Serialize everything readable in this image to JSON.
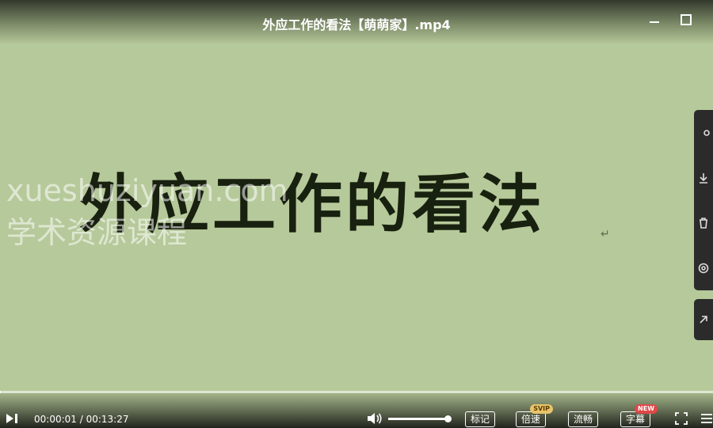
{
  "window": {
    "title": "外应工作的看法【萌萌家】.mp4"
  },
  "video": {
    "caption": "外应工作的看法",
    "return_mark": "↵",
    "watermark_line1": "xueshuziyuan.com",
    "watermark_line2": "学术资源课程"
  },
  "controls": {
    "current_time": "00:00:01",
    "separator": " / ",
    "duration": "00:13:27",
    "progress_fraction": 0.001,
    "volume_fraction": 1.0,
    "mark_label": "标记",
    "speed_label": "倍速",
    "speed_badge": "SVIP",
    "quality_label": "流畅",
    "subtitle_label": "字幕",
    "subtitle_badge": "NEW"
  },
  "icons": {
    "minimize": "minimize-icon",
    "maximize": "maximize-icon",
    "play": "play-pause-icon",
    "volume": "volume-icon",
    "fullscreen": "fullscreen-icon",
    "playlist": "playlist-icon"
  },
  "colors": {
    "video_background": "#b6c99a",
    "panel": "#2b2b2b",
    "text": "#ffffff"
  }
}
